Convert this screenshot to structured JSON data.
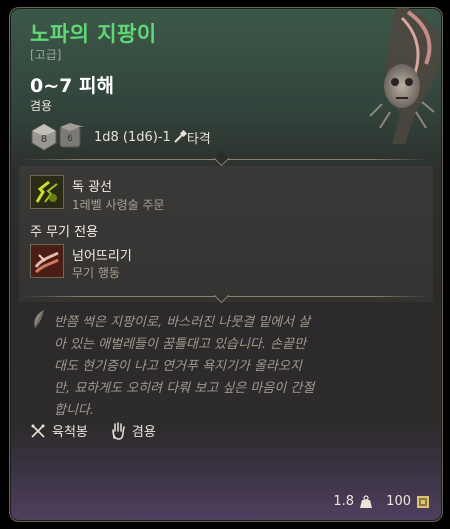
{
  "item": {
    "name": "노파의 지팡이",
    "rarity": "[고급]",
    "damage": "0~7 피해",
    "handedness": "겸용",
    "dice_formula": "1d8 (1d6)-1",
    "damage_type": "타격",
    "dice": {
      "main": "8",
      "alt": "6"
    }
  },
  "skills": [
    {
      "name": "독 광선",
      "sub": "1레벨 사령술 주문",
      "icon": "poison-ray-icon"
    },
    {
      "name": "넘어뜨리기",
      "sub": "무기 행동",
      "icon": "topple-icon"
    }
  ],
  "main_weapon_label": "주 무기 전용",
  "description": "반쯤 썩은 지팡이로, 바스러진 나뭇결 밑에서 살아 있는 애벌레들이 꿈틀대고 있습니다. 손끝만 대도 현기증이 나고 연거푸 욕지기가 올라오지만, 묘하게도 오히려 다뤄 보고 싶은 마음이 간절합니다.",
  "properties": [
    {
      "label": "육척봉",
      "icon": "quarterstaff-icon"
    },
    {
      "label": "겸용",
      "icon": "hand-icon"
    }
  ],
  "footer": {
    "weight": "1.8",
    "price": "100"
  },
  "colors": {
    "title": "#5fd776",
    "text": "#e8e2d6",
    "muted": "#a8a293",
    "bottom_tint": "#4f405f"
  }
}
